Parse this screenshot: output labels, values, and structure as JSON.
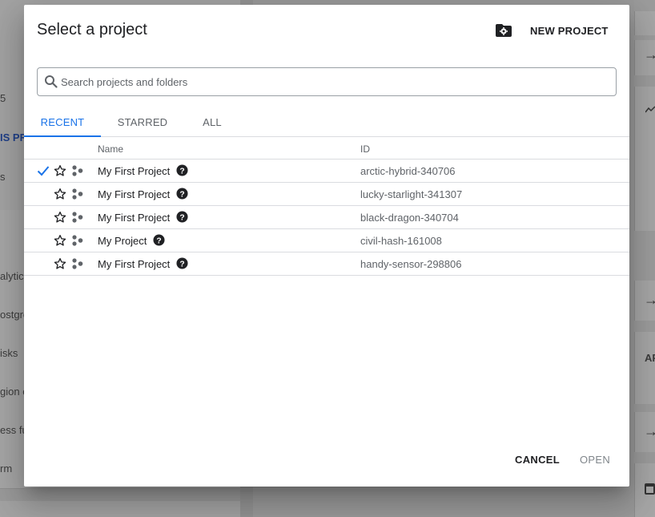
{
  "background": {
    "left_items": [
      {
        "text": "5",
        "style": "plain"
      },
      {
        "text": "IS PR",
        "style": "blue"
      },
      {
        "text": "s",
        "style": "plain"
      },
      {
        "text": "alytics",
        "style": "plain"
      },
      {
        "text": "ostgre",
        "style": "plain"
      },
      {
        "text": "isks",
        "style": "plain"
      },
      {
        "text": "gion o",
        "style": "plain"
      },
      {
        "text": "ess fu",
        "style": "plain"
      },
      {
        "text": "rm",
        "style": "plain"
      }
    ],
    "right_label": "AP"
  },
  "dialog": {
    "title": "Select a project",
    "new_project_label": "NEW PROJECT",
    "search": {
      "placeholder": "Search projects and folders",
      "value": ""
    },
    "tabs": [
      {
        "label": "RECENT",
        "active": true
      },
      {
        "label": "STARRED",
        "active": false
      },
      {
        "label": "ALL",
        "active": false
      }
    ],
    "table": {
      "headers": {
        "name": "Name",
        "id": "ID"
      },
      "rows": [
        {
          "name": "My First Project",
          "id": "arctic-hybrid-340706",
          "selected": true
        },
        {
          "name": "My First Project",
          "id": "lucky-starlight-341307",
          "selected": false
        },
        {
          "name": "My First Project",
          "id": "black-dragon-340704",
          "selected": false
        },
        {
          "name": "My Project",
          "id": "civil-hash-161008",
          "selected": false
        },
        {
          "name": "My First Project",
          "id": "handy-sensor-298806",
          "selected": false
        }
      ]
    },
    "buttons": {
      "cancel": "CANCEL",
      "open": "OPEN"
    }
  },
  "colors": {
    "accent": "#1a73e8",
    "text": "#202124",
    "muted": "#5f6368",
    "divider": "#dadce0"
  },
  "icons": [
    "search-icon",
    "folder-settings-icon",
    "check-icon",
    "star-outline-icon",
    "people-icon",
    "help-circle-icon"
  ]
}
